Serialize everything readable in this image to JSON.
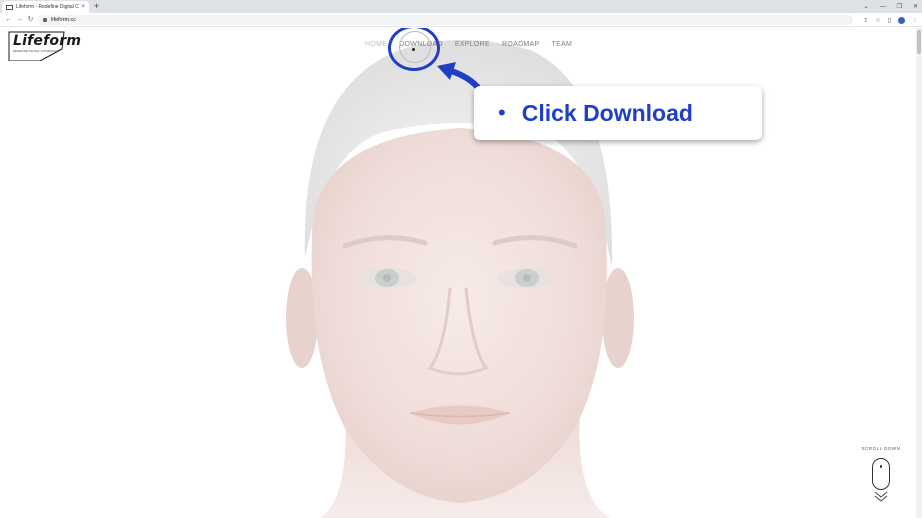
{
  "browser": {
    "tab_title": "Lifeform - Redefine Digital Cit",
    "tab_close": "×",
    "new_tab": "+",
    "url": "lifeform.cc",
    "nav_icons": [
      "back-arrow-icon",
      "forward-arrow-icon",
      "reload-icon"
    ],
    "window_controls": [
      "chevron-down-icon",
      "minimize-icon",
      "restore-icon",
      "close-icon"
    ],
    "toolbar_icons": [
      "share-icon",
      "star-icon",
      "side-panel-icon",
      "profile-icon",
      "more-icon"
    ]
  },
  "site": {
    "logo_text": "Lifeform",
    "logo_tagline": "REDEFINE DIGITAL CITIZENSHIP",
    "nav": [
      {
        "label": "HOME"
      },
      {
        "label": "DOWNLOAD"
      },
      {
        "label": "EXPLORE"
      },
      {
        "label": "ROADMAP"
      },
      {
        "label": "TEAM"
      }
    ],
    "scroll_hint": "SCROLL DOWN"
  },
  "annotation": {
    "callout_bullet": "•",
    "callout_text": "Click Download",
    "accent_color": "#1f3fc7"
  }
}
